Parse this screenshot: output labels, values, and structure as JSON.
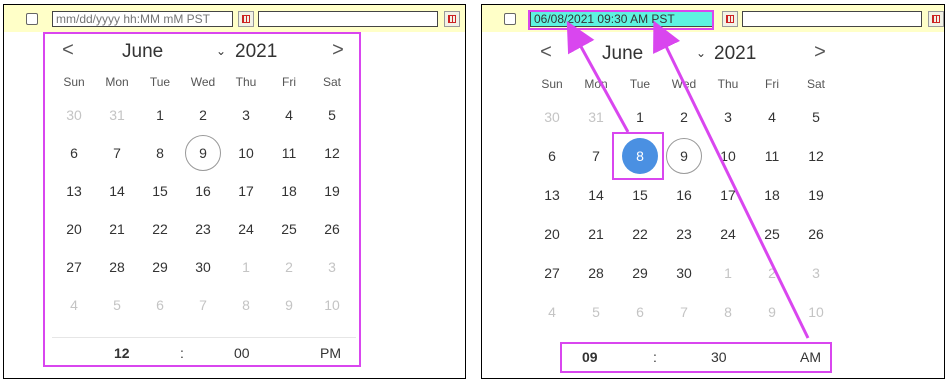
{
  "colors": {
    "highlight": "#d946ef",
    "selected_day": "#4a90e2",
    "input_highlight": "#5ef3e0",
    "topbar": "#ffffc8"
  },
  "left": {
    "datetime_input": {
      "placeholder": "mm/dd/yyyy hh:MM mM PST"
    },
    "calendar": {
      "month": "June",
      "year": "2021",
      "prev": "<",
      "next": ">",
      "dow": [
        "Sun",
        "Mon",
        "Tue",
        "Wed",
        "Thu",
        "Fri",
        "Sat"
      ],
      "weeks": [
        [
          "30",
          "31",
          "1",
          "2",
          "3",
          "4",
          "5"
        ],
        [
          "6",
          "7",
          "8",
          "9",
          "10",
          "11",
          "12"
        ],
        [
          "13",
          "14",
          "15",
          "16",
          "17",
          "18",
          "19"
        ],
        [
          "20",
          "21",
          "22",
          "23",
          "24",
          "25",
          "26"
        ],
        [
          "27",
          "28",
          "29",
          "30",
          "1",
          "2",
          "3"
        ],
        [
          "4",
          "5",
          "6",
          "7",
          "8",
          "9",
          "10"
        ]
      ],
      "today": "9",
      "time": {
        "hour": "12",
        "sep": ":",
        "minute": "00",
        "ampm": "PM"
      }
    }
  },
  "right": {
    "datetime_input": {
      "value": "06/08/2021 09:30 AM PST"
    },
    "calendar": {
      "month": "June",
      "year": "2021",
      "prev": "<",
      "next": ">",
      "dow": [
        "Sun",
        "Mon",
        "Tue",
        "Wed",
        "Thu",
        "Fri",
        "Sat"
      ],
      "weeks": [
        [
          "30",
          "31",
          "1",
          "2",
          "3",
          "4",
          "5"
        ],
        [
          "6",
          "7",
          "8",
          "9",
          "10",
          "11",
          "12"
        ],
        [
          "13",
          "14",
          "15",
          "16",
          "17",
          "18",
          "19"
        ],
        [
          "20",
          "21",
          "22",
          "23",
          "24",
          "25",
          "26"
        ],
        [
          "27",
          "28",
          "29",
          "30",
          "1",
          "2",
          "3"
        ],
        [
          "4",
          "5",
          "6",
          "7",
          "8",
          "9",
          "10"
        ]
      ],
      "selected": "8",
      "today": "9",
      "time": {
        "hour": "09",
        "sep": ":",
        "minute": "30",
        "ampm": "AM"
      }
    }
  }
}
